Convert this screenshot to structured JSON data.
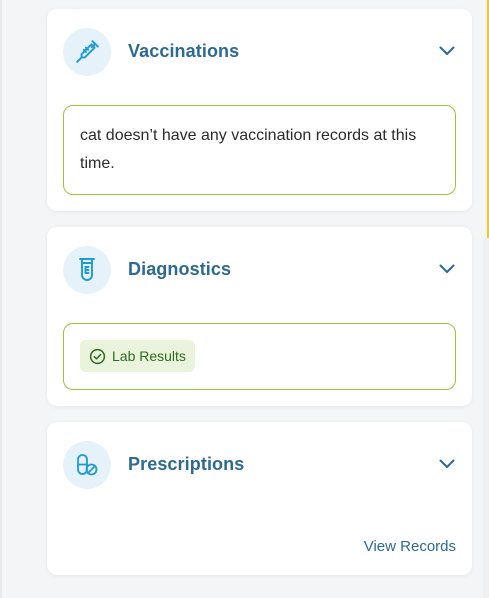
{
  "sections": {
    "vaccinations": {
      "title": "Vaccinations",
      "icon": "syringe-icon",
      "message": "cat doesn’t have any vaccination records at this time."
    },
    "diagnostics": {
      "title": "Diagnostics",
      "icon": "test-tube-icon",
      "lab_results_label": "Lab Results"
    },
    "prescriptions": {
      "title": "Prescriptions",
      "icon": "pills-icon",
      "view_records_label": "View Records"
    }
  },
  "colors": {
    "title": "#2c6a92",
    "icon": "#1e9ad6",
    "icon_bg": "#e5f2fa",
    "notice_border": "#9bc53d",
    "pill_bg": "#eaf4dc",
    "pill_text": "#2c6b1f"
  }
}
